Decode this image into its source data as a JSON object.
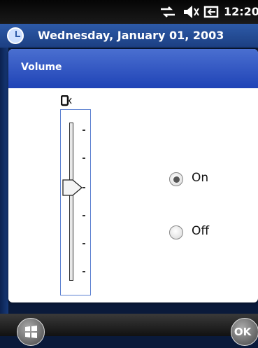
{
  "status_bar": {
    "time": "12:20",
    "icons": [
      "connectivity-icon",
      "speaker-muted-icon",
      "battery-icon"
    ]
  },
  "today_bar": {
    "date": "Wednesday, January 01, 2003"
  },
  "dialog": {
    "title": "Volume",
    "slider": {
      "ticks": 6,
      "level_fraction": 0.4
    },
    "options": [
      {
        "label": "On",
        "selected": true
      },
      {
        "label": "Off",
        "selected": false
      }
    ]
  },
  "softkeys": {
    "left": "start-icon",
    "right": "ok"
  },
  "colors": {
    "title_bar": "#1f43b6",
    "today_bar": "#2d5aa8"
  }
}
